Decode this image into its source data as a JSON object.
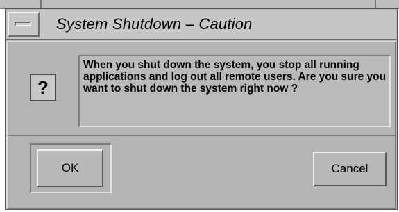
{
  "window": {
    "title": "System Shutdown – Caution"
  },
  "dialog": {
    "icon": "question-mark-icon",
    "icon_glyph": "?",
    "message": "When you shut down the system, you stop all running applications and log out all remote users. Are you sure you want to shut down the system right now ?"
  },
  "buttons": {
    "ok_label": "OK",
    "cancel_label": "Cancel"
  }
}
